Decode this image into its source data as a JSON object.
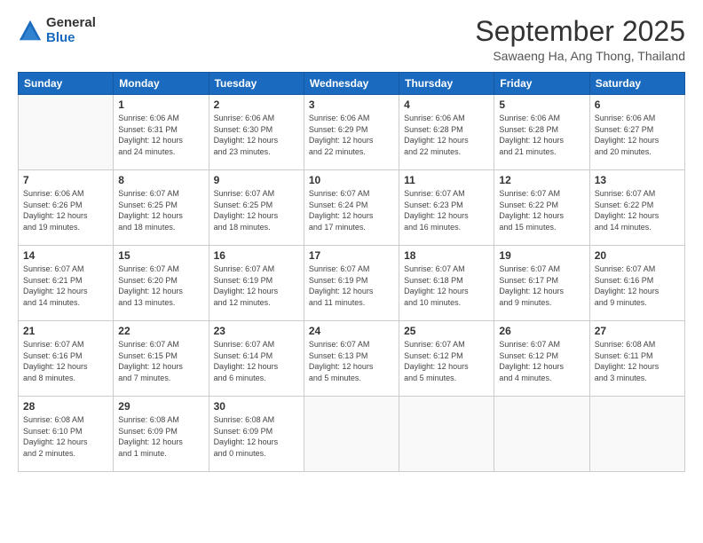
{
  "logo": {
    "general": "General",
    "blue": "Blue"
  },
  "title": "September 2025",
  "location": "Sawaeng Ha, Ang Thong, Thailand",
  "weekdays": [
    "Sunday",
    "Monday",
    "Tuesday",
    "Wednesday",
    "Thursday",
    "Friday",
    "Saturday"
  ],
  "weeks": [
    [
      {
        "day": "",
        "info": ""
      },
      {
        "day": "1",
        "info": "Sunrise: 6:06 AM\nSunset: 6:31 PM\nDaylight: 12 hours\nand 24 minutes."
      },
      {
        "day": "2",
        "info": "Sunrise: 6:06 AM\nSunset: 6:30 PM\nDaylight: 12 hours\nand 23 minutes."
      },
      {
        "day": "3",
        "info": "Sunrise: 6:06 AM\nSunset: 6:29 PM\nDaylight: 12 hours\nand 22 minutes."
      },
      {
        "day": "4",
        "info": "Sunrise: 6:06 AM\nSunset: 6:28 PM\nDaylight: 12 hours\nand 22 minutes."
      },
      {
        "day": "5",
        "info": "Sunrise: 6:06 AM\nSunset: 6:28 PM\nDaylight: 12 hours\nand 21 minutes."
      },
      {
        "day": "6",
        "info": "Sunrise: 6:06 AM\nSunset: 6:27 PM\nDaylight: 12 hours\nand 20 minutes."
      }
    ],
    [
      {
        "day": "7",
        "info": "Sunrise: 6:06 AM\nSunset: 6:26 PM\nDaylight: 12 hours\nand 19 minutes."
      },
      {
        "day": "8",
        "info": "Sunrise: 6:07 AM\nSunset: 6:25 PM\nDaylight: 12 hours\nand 18 minutes."
      },
      {
        "day": "9",
        "info": "Sunrise: 6:07 AM\nSunset: 6:25 PM\nDaylight: 12 hours\nand 18 minutes."
      },
      {
        "day": "10",
        "info": "Sunrise: 6:07 AM\nSunset: 6:24 PM\nDaylight: 12 hours\nand 17 minutes."
      },
      {
        "day": "11",
        "info": "Sunrise: 6:07 AM\nSunset: 6:23 PM\nDaylight: 12 hours\nand 16 minutes."
      },
      {
        "day": "12",
        "info": "Sunrise: 6:07 AM\nSunset: 6:22 PM\nDaylight: 12 hours\nand 15 minutes."
      },
      {
        "day": "13",
        "info": "Sunrise: 6:07 AM\nSunset: 6:22 PM\nDaylight: 12 hours\nand 14 minutes."
      }
    ],
    [
      {
        "day": "14",
        "info": "Sunrise: 6:07 AM\nSunset: 6:21 PM\nDaylight: 12 hours\nand 14 minutes."
      },
      {
        "day": "15",
        "info": "Sunrise: 6:07 AM\nSunset: 6:20 PM\nDaylight: 12 hours\nand 13 minutes."
      },
      {
        "day": "16",
        "info": "Sunrise: 6:07 AM\nSunset: 6:19 PM\nDaylight: 12 hours\nand 12 minutes."
      },
      {
        "day": "17",
        "info": "Sunrise: 6:07 AM\nSunset: 6:19 PM\nDaylight: 12 hours\nand 11 minutes."
      },
      {
        "day": "18",
        "info": "Sunrise: 6:07 AM\nSunset: 6:18 PM\nDaylight: 12 hours\nand 10 minutes."
      },
      {
        "day": "19",
        "info": "Sunrise: 6:07 AM\nSunset: 6:17 PM\nDaylight: 12 hours\nand 9 minutes."
      },
      {
        "day": "20",
        "info": "Sunrise: 6:07 AM\nSunset: 6:16 PM\nDaylight: 12 hours\nand 9 minutes."
      }
    ],
    [
      {
        "day": "21",
        "info": "Sunrise: 6:07 AM\nSunset: 6:16 PM\nDaylight: 12 hours\nand 8 minutes."
      },
      {
        "day": "22",
        "info": "Sunrise: 6:07 AM\nSunset: 6:15 PM\nDaylight: 12 hours\nand 7 minutes."
      },
      {
        "day": "23",
        "info": "Sunrise: 6:07 AM\nSunset: 6:14 PM\nDaylight: 12 hours\nand 6 minutes."
      },
      {
        "day": "24",
        "info": "Sunrise: 6:07 AM\nSunset: 6:13 PM\nDaylight: 12 hours\nand 5 minutes."
      },
      {
        "day": "25",
        "info": "Sunrise: 6:07 AM\nSunset: 6:12 PM\nDaylight: 12 hours\nand 5 minutes."
      },
      {
        "day": "26",
        "info": "Sunrise: 6:07 AM\nSunset: 6:12 PM\nDaylight: 12 hours\nand 4 minutes."
      },
      {
        "day": "27",
        "info": "Sunrise: 6:08 AM\nSunset: 6:11 PM\nDaylight: 12 hours\nand 3 minutes."
      }
    ],
    [
      {
        "day": "28",
        "info": "Sunrise: 6:08 AM\nSunset: 6:10 PM\nDaylight: 12 hours\nand 2 minutes."
      },
      {
        "day": "29",
        "info": "Sunrise: 6:08 AM\nSunset: 6:09 PM\nDaylight: 12 hours\nand 1 minute."
      },
      {
        "day": "30",
        "info": "Sunrise: 6:08 AM\nSunset: 6:09 PM\nDaylight: 12 hours\nand 0 minutes."
      },
      {
        "day": "",
        "info": ""
      },
      {
        "day": "",
        "info": ""
      },
      {
        "day": "",
        "info": ""
      },
      {
        "day": "",
        "info": ""
      }
    ]
  ]
}
